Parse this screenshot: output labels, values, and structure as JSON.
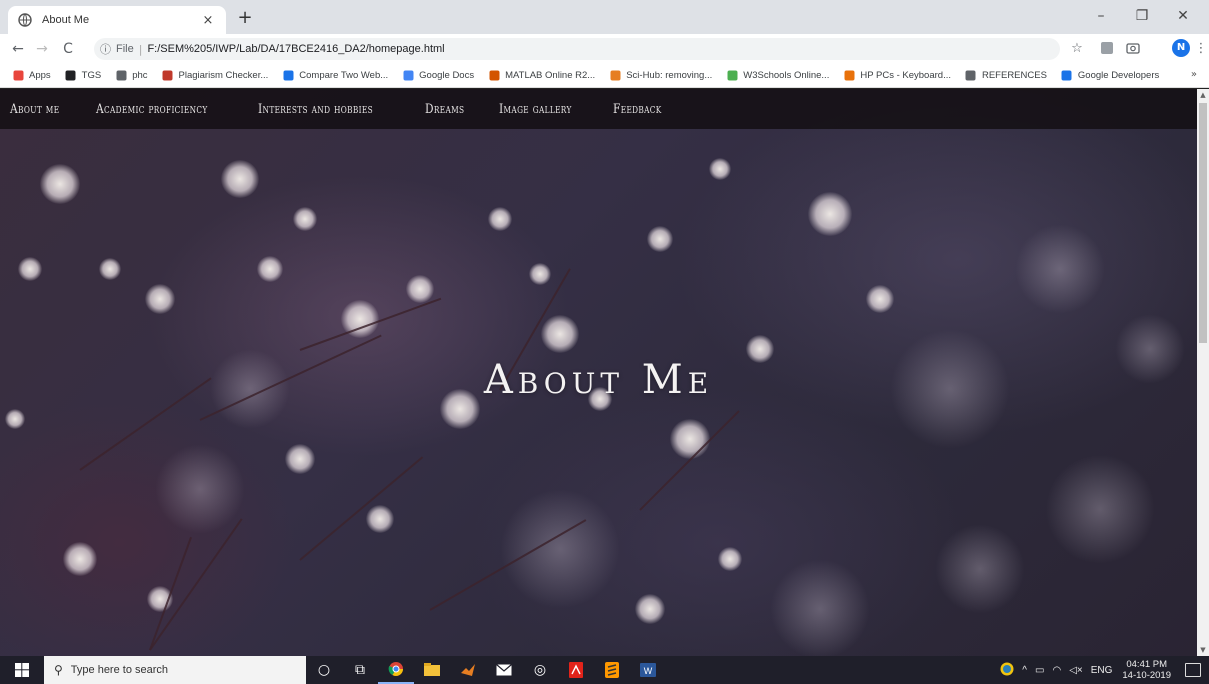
{
  "browser": {
    "tab": {
      "title": "About Me",
      "close_glyph": "×",
      "favicon": "globe-icon"
    },
    "new_tab_glyph": "+",
    "window_controls": {
      "minimize": "–",
      "maximize": "❐",
      "close": "✕"
    },
    "nav": {
      "back": "←",
      "forward": "→",
      "reload": "C"
    },
    "address": {
      "info_glyph": "ⓘ",
      "scheme": "File",
      "url": "F:/SEM%205/IWP/Lab/DA/17BCE2416_DA2/homepage.html"
    },
    "avatar_letter": "N",
    "menu_glyph": "⋮",
    "star_glyph": "☆"
  },
  "bookmarks": [
    {
      "label": "Apps",
      "icon": "apps-grid-icon",
      "color": "#e8453c"
    },
    {
      "label": "TGS",
      "icon": "tools-icon",
      "color": "#202124"
    },
    {
      "label": "phc",
      "icon": "globe-icon",
      "color": "#5f6368"
    },
    {
      "label": "Plagiarism Checker...",
      "icon": "sst-icon",
      "color": "#c0392b"
    },
    {
      "label": "Compare Two Web...",
      "icon": "c-logo-icon",
      "color": "#1a73e8"
    },
    {
      "label": "Google Docs",
      "icon": "docs-icon",
      "color": "#4285f4"
    },
    {
      "label": "MATLAB Online R2...",
      "icon": "matlab-icon",
      "color": "#d35400"
    },
    {
      "label": "Sci-Hub: removing...",
      "icon": "scihub-icon",
      "color": "#e67e22"
    },
    {
      "label": "W3Schools Online...",
      "icon": "w3-icon",
      "color": "#4caf50"
    },
    {
      "label": "HP PCs - Keyboard...",
      "icon": "hp-icon",
      "color": "#e8710a"
    },
    {
      "label": "REFERENCES",
      "icon": "globe-icon",
      "color": "#5f6368"
    },
    {
      "label": "Google Developers",
      "icon": "dev-icon",
      "color": "#1a73e8"
    }
  ],
  "bookmarks_more": "»",
  "site": {
    "nav": [
      {
        "label": "About me"
      },
      {
        "label": "Academic proficiency"
      },
      {
        "label": "Interests and hobbies"
      },
      {
        "label": "Dreams"
      },
      {
        "label": "Image gallery"
      },
      {
        "label": "Feedback"
      }
    ],
    "hero_title": "About Me"
  },
  "taskbar": {
    "search_placeholder": "Type here to search",
    "tray": {
      "lang": "ENG",
      "time": "04:41 PM",
      "date": "14-10-2019"
    }
  }
}
